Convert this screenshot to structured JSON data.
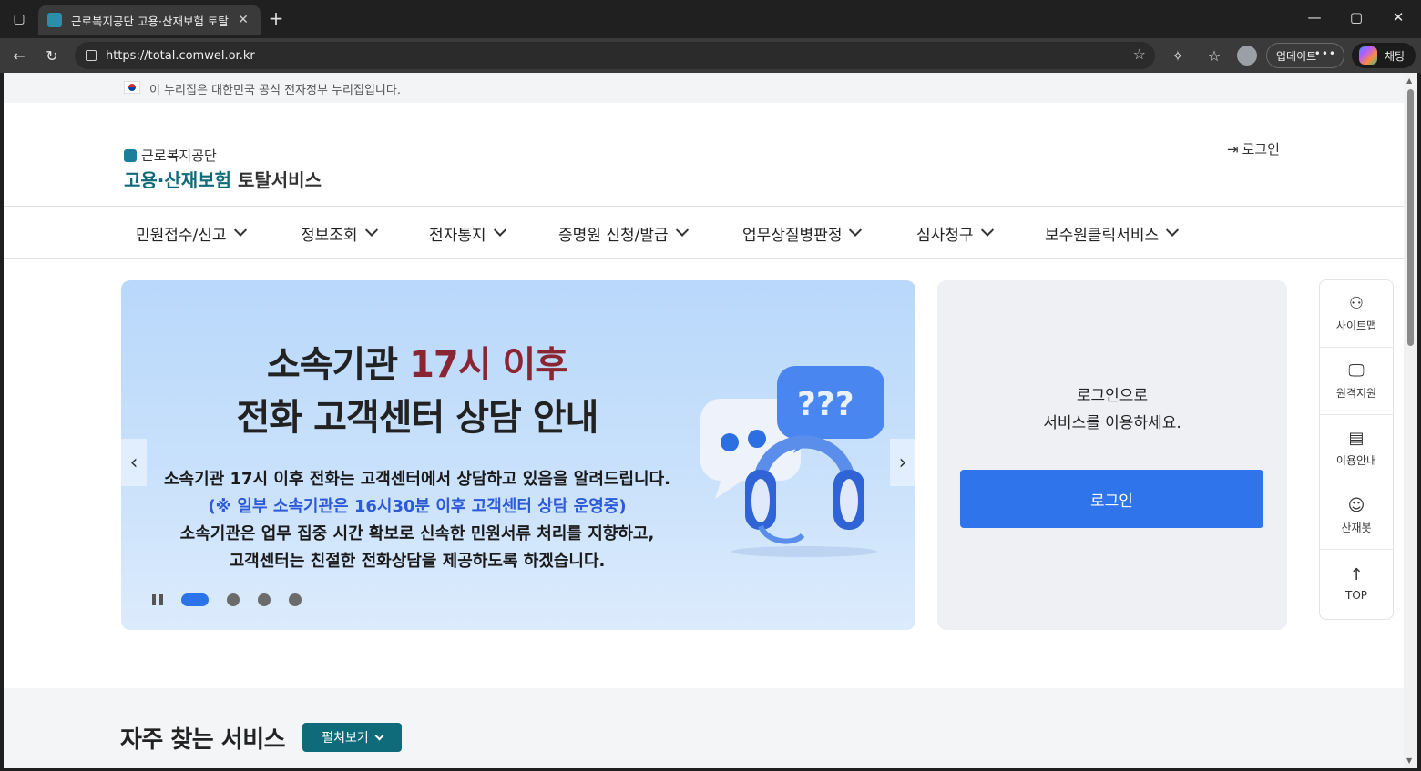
{
  "browser": {
    "tab_title": "근로복지공단 고용·산재보험 토탈",
    "url": "https://total.comwel.or.kr",
    "update_label": "업데이트",
    "chat_label": "채팅"
  },
  "gov_banner": {
    "text": "이 누리집은 대한민국 공식 전자정부 누리집입니다."
  },
  "header": {
    "org_name": "근로복지공단",
    "service_name_colored": "고용·산재보험",
    "service_name_dark": "토탈서비스",
    "login_link": "로그인"
  },
  "gnb": {
    "items": [
      {
        "label": "민원접수/신고"
      },
      {
        "label": "정보조회"
      },
      {
        "label": "전자통지"
      },
      {
        "label": "증명원 신청/발급"
      },
      {
        "label": "업무상질병판정"
      },
      {
        "label": "심사청구"
      },
      {
        "label": "보수원클릭서비스"
      }
    ]
  },
  "hero": {
    "title_line1_a": "소속기관",
    "title_line1_b": "17시 이후",
    "title_line2": "전화 고객센터 상담 안내",
    "body1": "소속기관 17시 이후 전화는 고객센터에서 상담하고 있음을 알려드립니다.",
    "body2": "(※ 일부 소속기관은 16시30분 이후 고객센터 상담 운영중)",
    "body3": "소속기관은 업무 집중 시간 확보로 신속한 민원서류 처리를 지향하고,",
    "body4": "고객센터는 친절한 전화상담을 제공하도록 하겠습니다.",
    "slide_count": 4,
    "active_slide": 1,
    "colors": {
      "highlight": "#8a2532",
      "notice": "#2c5ad8"
    }
  },
  "login_panel": {
    "msg_line1": "로그인으로",
    "msg_line2": "서비스를 이용하세요.",
    "button": "로그인",
    "button_color": "#2f74ea"
  },
  "quick_menu": {
    "items": [
      {
        "label": "사이트맵",
        "icon": "sitemap-icon"
      },
      {
        "label": "원격지원",
        "icon": "remote-support-icon"
      },
      {
        "label": "이용안내",
        "icon": "guide-icon"
      },
      {
        "label": "산재봇",
        "icon": "robot-icon"
      },
      {
        "label": "TOP",
        "icon": "arrow-up-icon"
      }
    ]
  },
  "frequent": {
    "title": "자주 찾는 서비스",
    "expand_button": "펼쳐보기",
    "accent": "#0f6b7a"
  }
}
